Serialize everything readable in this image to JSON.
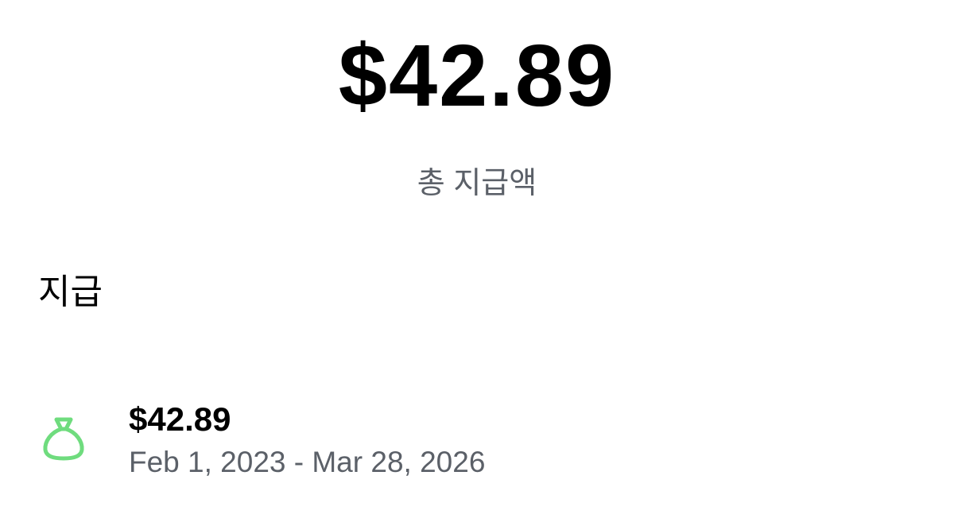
{
  "summary": {
    "total_amount": "$42.89",
    "total_label": "총 지급액"
  },
  "payouts": {
    "section_title": "지급",
    "items": [
      {
        "icon": "money-bag-icon",
        "amount": "$42.89",
        "date_range": "Feb 1, 2023 - Mar 28, 2026"
      }
    ]
  },
  "colors": {
    "text_primary": "#000000",
    "text_secondary": "#5b6068",
    "icon_green": "#6fdc7e"
  }
}
